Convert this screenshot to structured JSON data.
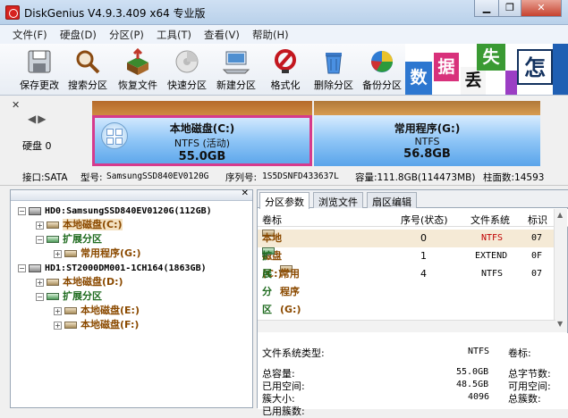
{
  "title": "DiskGenius V4.9.3.409 x64 专业版",
  "window_controls": {
    "minimize": "▁",
    "restore": "❐",
    "close": "✕"
  },
  "menu": [
    "文件(F)",
    "硬盘(D)",
    "分区(P)",
    "工具(T)",
    "查看(V)",
    "帮助(H)"
  ],
  "toolbar": [
    {
      "label": "保存更改",
      "icon": "save-icon"
    },
    {
      "label": "搜索分区",
      "icon": "magnifier-icon"
    },
    {
      "label": "恢复文件",
      "icon": "recover-icon"
    },
    {
      "label": "快速分区",
      "icon": "quick-partition-icon"
    },
    {
      "label": "新建分区",
      "icon": "new-partition-icon"
    },
    {
      "label": "格式化",
      "icon": "format-icon"
    },
    {
      "label": "删除分区",
      "icon": "trash-icon"
    },
    {
      "label": "备份分区",
      "icon": "backup-pie-icon"
    }
  ],
  "ad_tiles": [
    "数",
    "据",
    "丢",
    "失",
    "怎"
  ],
  "disk_map": {
    "disk_label": "硬盘 0",
    "partitions": [
      {
        "name": "本地磁盘(C:)",
        "fs": "NTFS (活动)",
        "size": "55.0GB"
      },
      {
        "name": "常用程序(G:)",
        "fs": "NTFS",
        "size": "56.8GB"
      }
    ]
  },
  "info": {
    "iface": "接口:SATA",
    "model_label": "型号:",
    "model": "SamsungSSD840EV0120G",
    "serial_label": "序列号:",
    "serial": "1S5DSNFD433637L",
    "capacity": "容量:111.8GB(114473MB)",
    "cylinders": "柱面数:14593"
  },
  "tree": {
    "disk0": "HD0:SamsungSSD840EV0120G(112GB)",
    "disk0_p1": "本地磁盘(C:)",
    "disk0_ext": "扩展分区",
    "disk0_p2": "常用程序(G:)",
    "disk1": "HD1:ST2000DM001-1CH164(1863GB)",
    "disk1_p1": "本地磁盘(D:)",
    "disk1_ext": "扩展分区",
    "disk1_p2": "本地磁盘(E:)",
    "disk1_p3": "本地磁盘(F:)"
  },
  "tabs": [
    "分区参数",
    "浏览文件",
    "扇区编辑"
  ],
  "grid": {
    "headers": [
      "卷标",
      "序号(状态)",
      "文件系统",
      "标识"
    ],
    "rows": [
      {
        "name": "本地磁盘(C:)",
        "index": "0",
        "fs": "NTFS",
        "id": "07"
      },
      {
        "name": "扩展分区",
        "index": "1",
        "fs": "EXTEND",
        "id": "0F"
      },
      {
        "name": "常用程序(G:)",
        "index": "4",
        "fs": "NTFS",
        "id": "07"
      }
    ]
  },
  "detail": {
    "fs_type_label": "文件系统类型:",
    "fs_type": "NTFS",
    "vol_label": "卷标:",
    "total_label": "总容量:",
    "total": "55.0GB",
    "used_label": "已用空间:",
    "used": "48.5GB",
    "cluster_label": "簇大小:",
    "cluster": "4096",
    "unused_label": "已用簇数:",
    "bytes_label": "总字节数:",
    "free_label": "可用空间:",
    "clusters_label": "总簇数:"
  }
}
